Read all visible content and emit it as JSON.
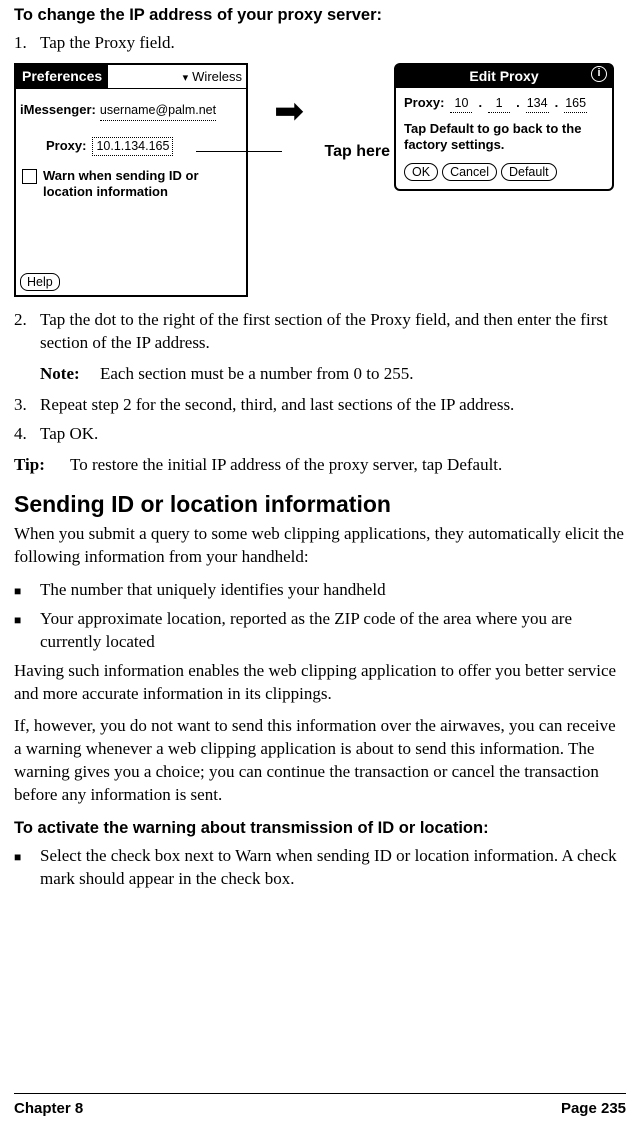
{
  "title1": "To change the IP address of your proxy server:",
  "steps": {
    "s1": {
      "num": "1.",
      "text": "Tap the Proxy field."
    },
    "s2": {
      "num": "2.",
      "text": "Tap the dot to the right of the first section of the Proxy field, and then enter the first section of the IP address."
    },
    "s3": {
      "num": "3.",
      "text": "Repeat step 2 for the second, third, and last sections of the IP address."
    },
    "s4": {
      "num": "4.",
      "text": "Tap OK."
    }
  },
  "note": {
    "label": "Note:",
    "text": "Each section must be a number from 0 to 255."
  },
  "tip": {
    "label": "Tip:",
    "text": "To restore the initial IP address of the proxy server, tap Default."
  },
  "h2": "Sending ID or location information",
  "para1": "When you submit a query to some web clipping applications, they automatically elicit the following information from your handheld:",
  "bullets": {
    "b1": "The number that uniquely identifies your handheld",
    "b2": "Your approximate location, reported as the ZIP code of the area where you are currently located"
  },
  "para2": "Having such information enables the web clipping application to offer you better service and more accurate information in its clippings.",
  "para3": "If, however, you do not want to send this information over the airwaves, you can receive a warning whenever a web clipping application is about to send this information. The warning gives you a choice; you can continue the transaction or cancel the transaction before any information is sent.",
  "title2": "To activate the warning about transmission of ID or location:",
  "bullet_final": "Select the check box next to Warn when sending ID or location information. A check mark should appear in the check box.",
  "footer": {
    "left": "Chapter 8",
    "right": "Page 235"
  },
  "prefs": {
    "title": "Preferences",
    "menu": "Wireless",
    "imessenger_label": "iMessenger:",
    "imessenger_val": "username@palm.net",
    "proxy_label": "Proxy:",
    "proxy_val": "10.1.134.165",
    "warn_text": "Warn when sending ID or location information",
    "help": "Help"
  },
  "tap_here": "Tap here",
  "edit": {
    "title": "Edit Proxy",
    "proxy_label": "Proxy:",
    "seg1": "10",
    "seg2": "1",
    "seg3": "134",
    "seg4": "165",
    "msg": "Tap Default to go back to the factory settings.",
    "ok": "OK",
    "cancel": "Cancel",
    "default": "Default"
  }
}
